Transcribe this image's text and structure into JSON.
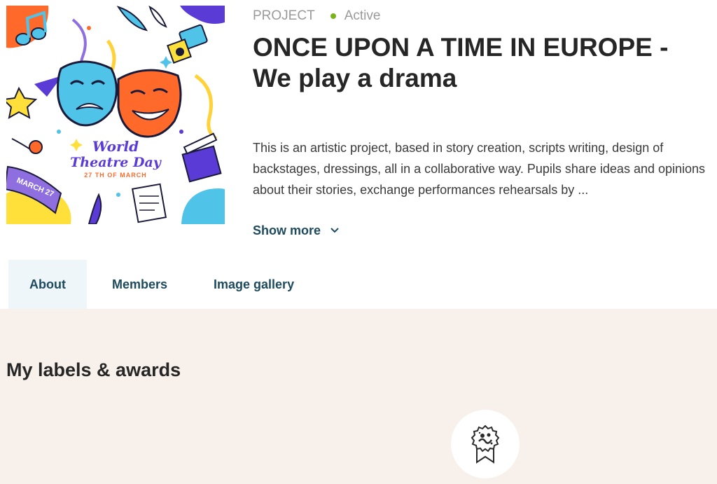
{
  "project": {
    "type_label": "PROJECT",
    "status": "Active",
    "status_color": "#7bb31a",
    "title": "ONCE UPON A TIME IN EUROPE - We play a drama",
    "description": "This is an artistic project, based in story creation, scripts writing, design of backstages, dressings, all in a collaborative way. Pupils share ideas and opinions about their stories, exchange performances rehearsals by ...",
    "show_more_label": "Show more",
    "image": {
      "line1": "World",
      "line2": "Theatre Day",
      "date": "27 TH OF MARCH",
      "ribbon": "MARCH 27"
    }
  },
  "tabs": [
    {
      "label": "About",
      "active": true
    },
    {
      "label": "Members",
      "active": false
    },
    {
      "label": "Image gallery",
      "active": false
    }
  ],
  "awards": {
    "title": "My labels & awards",
    "items": [
      {
        "icon": "award-badge-icon"
      }
    ]
  },
  "colors": {
    "accent_text": "#1d4a5d",
    "tab_active_bg": "#eef6fa",
    "section_bg": "#f8f0ea"
  }
}
